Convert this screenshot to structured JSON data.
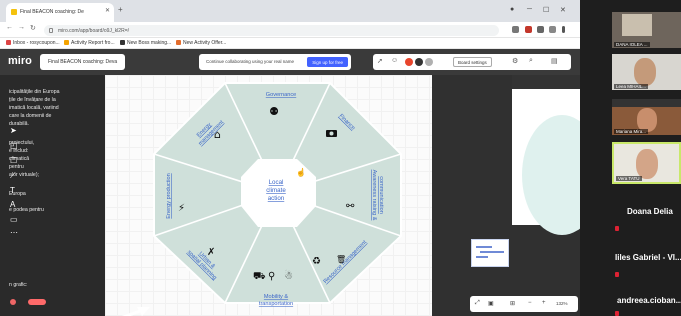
{
  "browser": {
    "tab_title": "Final BEACON coaching: De",
    "url": "miro.com/app/board/o9J_kl2R=/",
    "bookmarks": [
      "Inbox - rosycoupon...",
      "Activity Report fro...",
      "New Boss making...",
      "New Activity Offer..."
    ]
  },
  "miro": {
    "logo": "miro",
    "board_name": "Final BEACON coaching: Deva",
    "collab_text": "Continue collaborating using your real name",
    "signup_label": "Sign up for free",
    "share_label": "Board settings",
    "zoom": "132%"
  },
  "left_text": [
    "icipalitățile din Europa",
    "țile de învățare de la",
    "imatică locală, variind",
    "care la domenii de",
    "durabilă.",
    "proiectului,",
    "e includ:",
    "climatică",
    "pentru",
    "alor virtuale);",
    "Europa",
    "e podea pentru"
  ],
  "bottom_left_text": "n grafic:",
  "octagon": {
    "center": "Local\nclimate\naction",
    "sectors": [
      "Governance",
      "Finance",
      "Awareness raising &\ncommunication",
      "Resource management",
      "Mobility &\ntransportation",
      "Urban &\nspatial planning",
      "Energy production",
      "Energy\nmanagement"
    ]
  },
  "participants": {
    "thumbs": [
      "DANA IOLEA ...",
      "Leea MIHAIL...",
      "Mariana Mira...",
      "Vera TATU"
    ],
    "names": [
      "Doana Delia",
      "Iiles Gabriel - VI...",
      "andreea.cioban..."
    ]
  },
  "colors": {
    "octagon_fill": "#cfe0da",
    "label_blue": "#3b66c8",
    "accent": "#4262ff"
  }
}
